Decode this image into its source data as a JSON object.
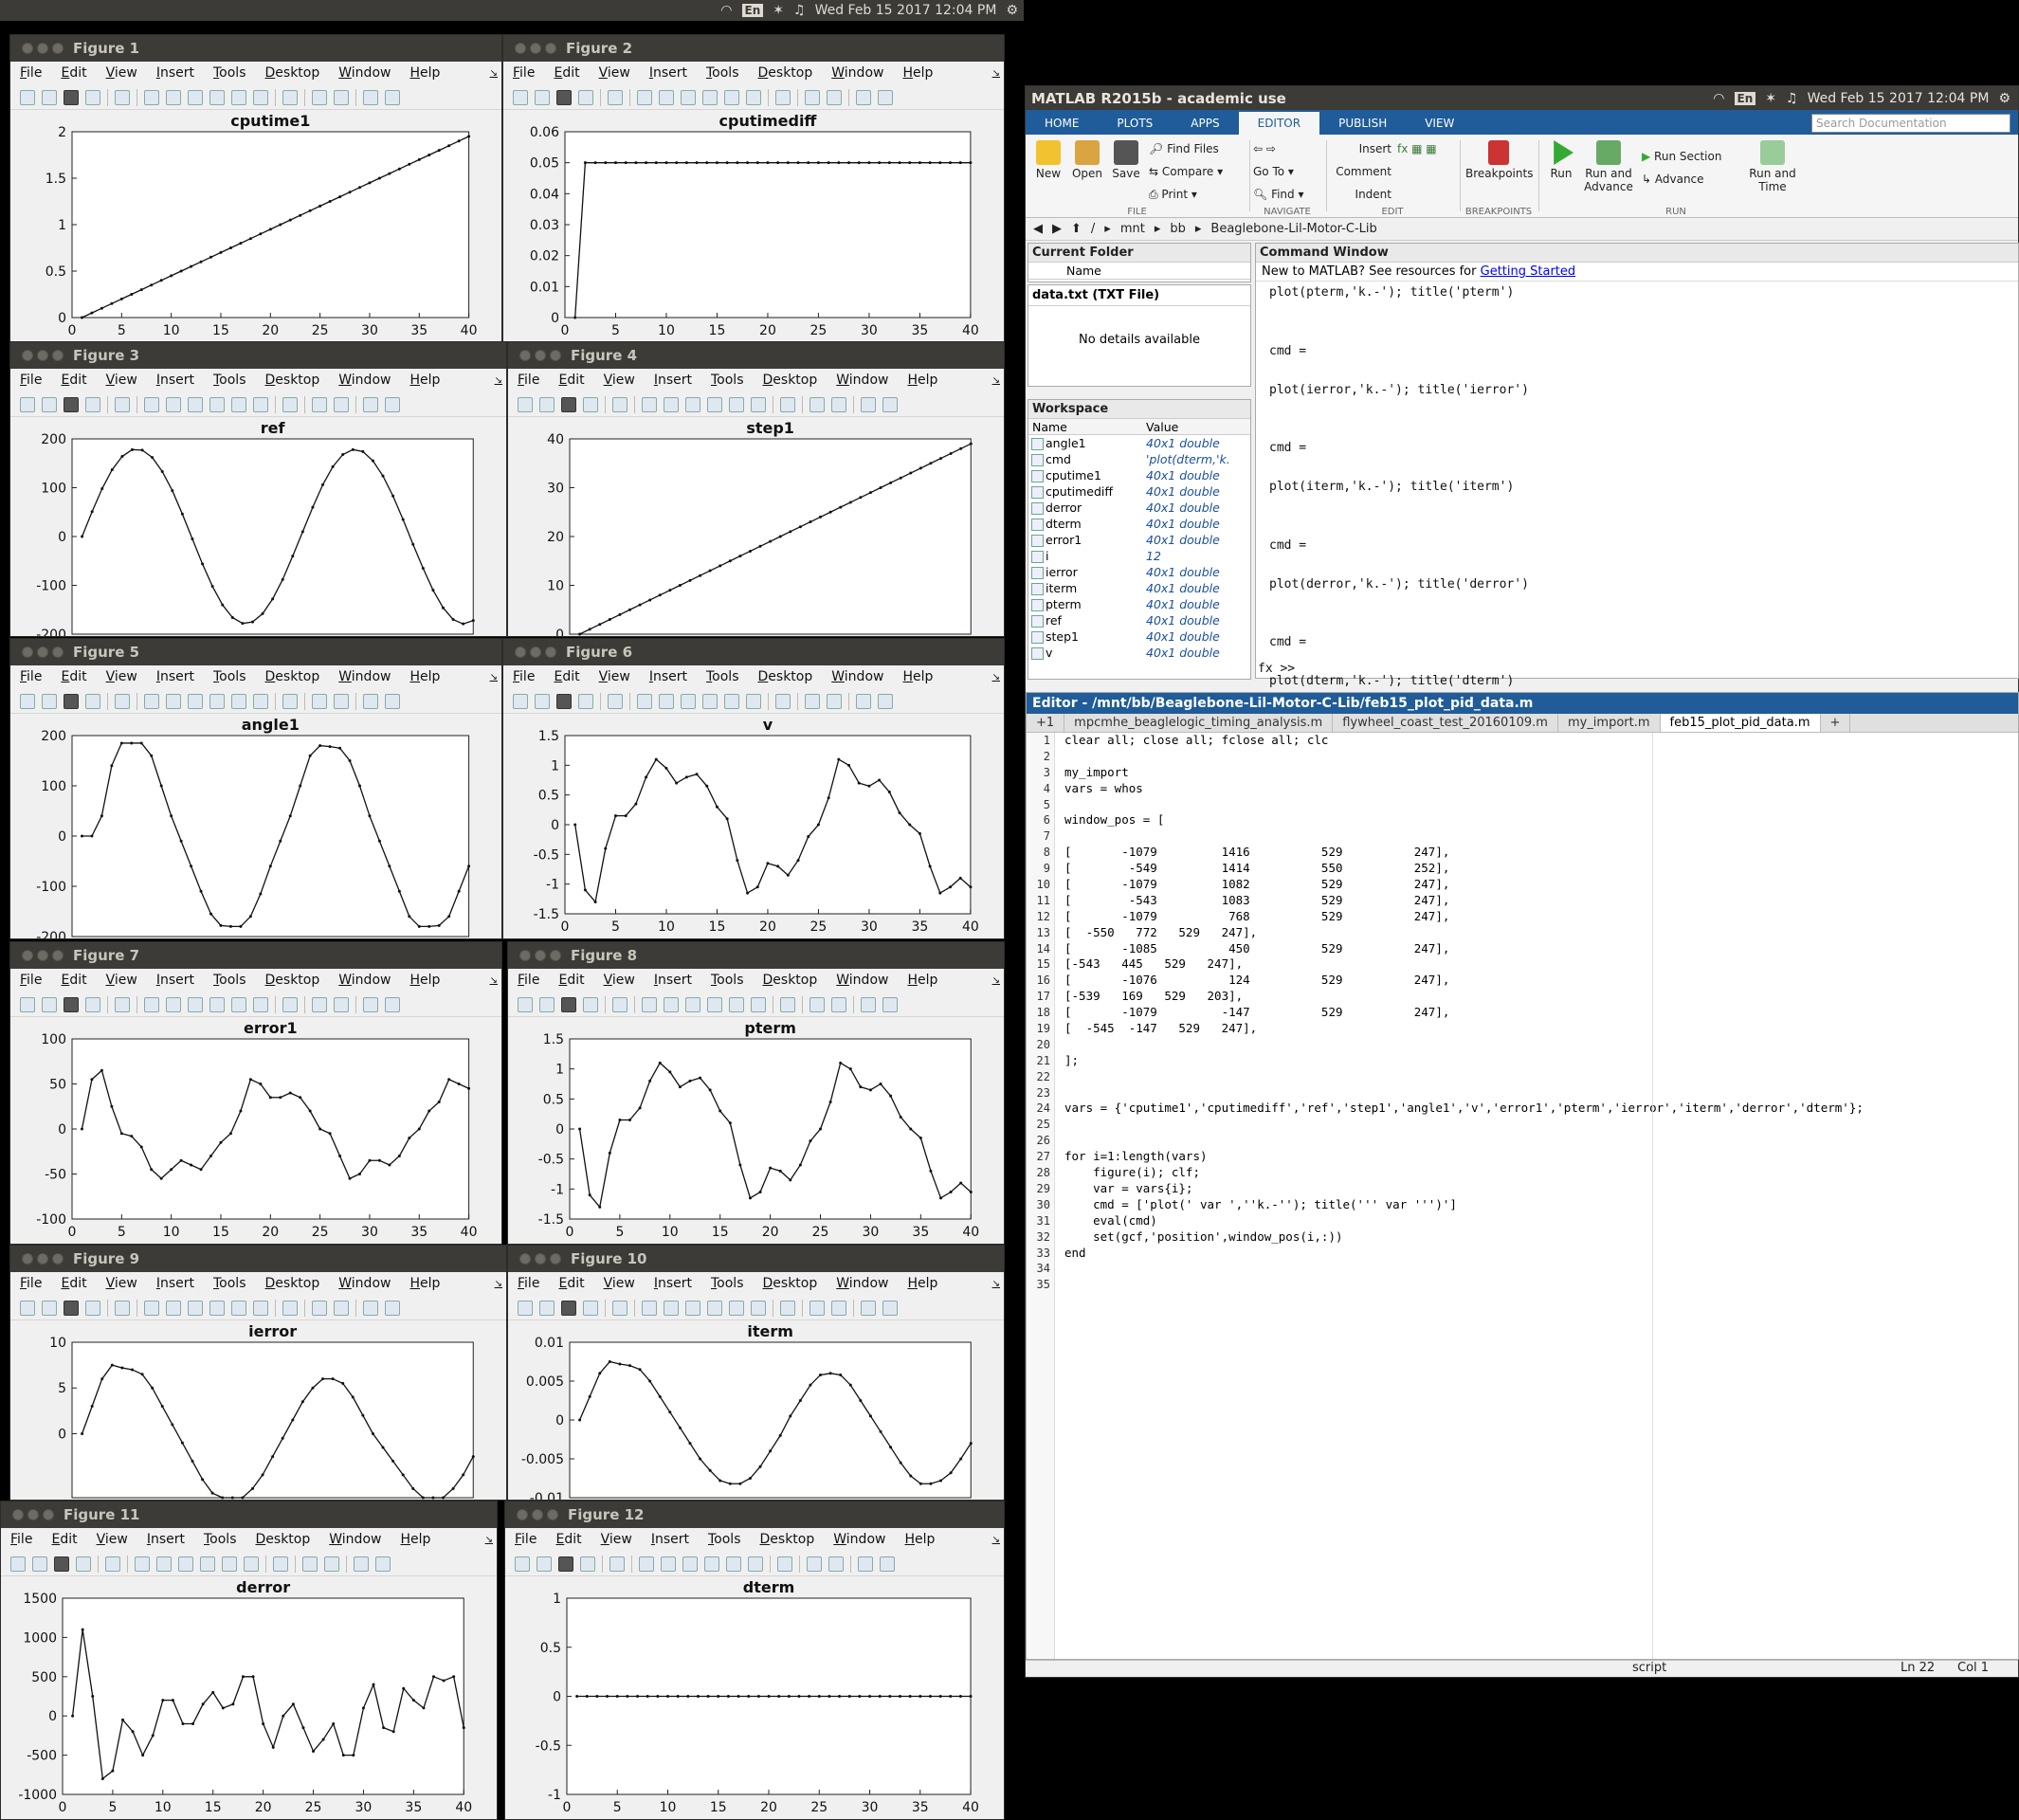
{
  "topbar_left": {
    "lang": "En",
    "datetime": "Wed Feb 15 2017 12:04 PM"
  },
  "figure_menu": [
    "File",
    "Edit",
    "View",
    "Insert",
    "Tools",
    "Desktop",
    "Window",
    "Help"
  ],
  "figures": [
    {
      "window_title": "Figure 1",
      "chart_data": {
        "type": "line",
        "title": "cputime1",
        "xlim": [
          0,
          40
        ],
        "ylim": [
          0,
          2
        ],
        "xticks": [
          0,
          5,
          10,
          15,
          20,
          25,
          30,
          35,
          40
        ],
        "yticks": [
          0,
          0.5,
          1,
          1.5,
          2
        ],
        "y": [
          0,
          0.05,
          0.1,
          0.15,
          0.2,
          0.25,
          0.3,
          0.35,
          0.4,
          0.45,
          0.5,
          0.55,
          0.6,
          0.65,
          0.7,
          0.75,
          0.8,
          0.85,
          0.9,
          0.95,
          1,
          1.05,
          1.1,
          1.15,
          1.2,
          1.25,
          1.3,
          1.35,
          1.4,
          1.45,
          1.5,
          1.55,
          1.6,
          1.65,
          1.7,
          1.75,
          1.8,
          1.85,
          1.9,
          1.95
        ]
      }
    },
    {
      "window_title": "Figure 2",
      "chart_data": {
        "type": "line",
        "title": "cputimediff",
        "xlim": [
          0,
          40
        ],
        "ylim": [
          0,
          0.06
        ],
        "xticks": [
          0,
          5,
          10,
          15,
          20,
          25,
          30,
          35,
          40
        ],
        "yticks": [
          0,
          0.01,
          0.02,
          0.03,
          0.04,
          0.05,
          0.06
        ],
        "y": [
          0,
          0.05,
          0.05,
          0.05,
          0.05,
          0.05,
          0.05,
          0.05,
          0.05,
          0.05,
          0.05,
          0.05,
          0.05,
          0.05,
          0.05,
          0.05,
          0.05,
          0.05,
          0.05,
          0.05,
          0.05,
          0.05,
          0.05,
          0.05,
          0.05,
          0.05,
          0.05,
          0.05,
          0.05,
          0.05,
          0.05,
          0.05,
          0.05,
          0.05,
          0.05,
          0.05,
          0.05,
          0.05,
          0.05,
          0.05
        ]
      }
    },
    {
      "window_title": "Figure 3",
      "chart_data": {
        "type": "line",
        "title": "ref",
        "xlim": [
          0,
          40
        ],
        "ylim": [
          -200,
          200
        ],
        "xticks": [],
        "yticks": [
          -200,
          -100,
          0,
          100,
          200
        ],
        "y": [
          0,
          51,
          98,
          137,
          164,
          178,
          177,
          162,
          133,
          94,
          46,
          -5,
          -56,
          -102,
          -140,
          -166,
          -178,
          -175,
          -158,
          -128,
          -88,
          -40,
          10,
          60,
          106,
          143,
          168,
          178,
          174,
          155,
          124,
          83,
          35,
          -16,
          -65,
          -110,
          -146,
          -170,
          -179,
          -172
        ]
      }
    },
    {
      "window_title": "Figure 4",
      "chart_data": {
        "type": "line",
        "title": "step1",
        "xlim": [
          0,
          40
        ],
        "ylim": [
          0,
          40
        ],
        "xticks": [],
        "yticks": [
          0,
          10,
          20,
          30,
          40
        ],
        "y": [
          0,
          1,
          2,
          3,
          4,
          5,
          6,
          7,
          8,
          9,
          10,
          11,
          12,
          13,
          14,
          15,
          16,
          17,
          18,
          19,
          20,
          21,
          22,
          23,
          24,
          25,
          26,
          27,
          28,
          29,
          30,
          31,
          32,
          33,
          34,
          35,
          36,
          37,
          38,
          39
        ]
      }
    },
    {
      "window_title": "Figure 5",
      "chart_data": {
        "type": "line",
        "title": "angle1",
        "xlim": [
          0,
          40
        ],
        "ylim": [
          -200,
          200
        ],
        "xticks": [],
        "yticks": [
          -200,
          -100,
          0,
          100,
          200
        ],
        "y": [
          0,
          0,
          40,
          140,
          185,
          185,
          185,
          160,
          100,
          40,
          -10,
          -60,
          -110,
          -155,
          -178,
          -180,
          -180,
          -160,
          -115,
          -60,
          -10,
          40,
          100,
          160,
          180,
          178,
          175,
          150,
          100,
          40,
          -10,
          -60,
          -110,
          -160,
          -180,
          -180,
          -178,
          -160,
          -110,
          -60
        ]
      }
    },
    {
      "window_title": "Figure 6",
      "chart_data": {
        "type": "line",
        "title": "v",
        "xlim": [
          0,
          40
        ],
        "ylim": [
          -1.5,
          1.5
        ],
        "xticks": [
          0,
          5,
          10,
          15,
          20,
          25,
          30,
          35,
          40
        ],
        "yticks": [
          -1.5,
          -1,
          -0.5,
          0,
          0.5,
          1,
          1.5
        ],
        "y": [
          0,
          -1.1,
          -1.3,
          -0.4,
          0.15,
          0.15,
          0.35,
          0.8,
          1.1,
          0.95,
          0.7,
          0.8,
          0.85,
          0.65,
          0.3,
          0.1,
          -0.6,
          -1.15,
          -1.05,
          -0.65,
          -0.7,
          -0.85,
          -0.6,
          -0.2,
          0.0,
          0.45,
          1.1,
          1.0,
          0.7,
          0.65,
          0.75,
          0.55,
          0.2,
          0.0,
          -0.15,
          -0.7,
          -1.15,
          -1.05,
          -0.9,
          -1.05
        ]
      }
    },
    {
      "window_title": "Figure 7",
      "chart_data": {
        "type": "line",
        "title": "error1",
        "xlim": [
          0,
          40
        ],
        "ylim": [
          -100,
          100
        ],
        "xticks": [
          0,
          5,
          10,
          15,
          20,
          25,
          30,
          35,
          40
        ],
        "yticks": [
          -100,
          -50,
          0,
          50,
          100
        ],
        "y": [
          0,
          55,
          65,
          25,
          -5,
          -8,
          -20,
          -45,
          -55,
          -45,
          -35,
          -40,
          -45,
          -30,
          -15,
          -5,
          20,
          55,
          50,
          35,
          35,
          40,
          35,
          20,
          0,
          -5,
          -30,
          -55,
          -50,
          -35,
          -35,
          -40,
          -30,
          -10,
          0,
          20,
          30,
          55,
          50,
          45
        ]
      }
    },
    {
      "window_title": "Figure 8",
      "chart_data": {
        "type": "line",
        "title": "pterm",
        "xlim": [
          0,
          40
        ],
        "ylim": [
          -1.5,
          1.5
        ],
        "xticks": [
          0,
          5,
          10,
          15,
          20,
          25,
          30,
          35,
          40
        ],
        "yticks": [
          -1.5,
          -1,
          -0.5,
          0,
          0.5,
          1,
          1.5
        ],
        "y": [
          0,
          -1.1,
          -1.3,
          -0.4,
          0.15,
          0.15,
          0.35,
          0.8,
          1.1,
          0.95,
          0.7,
          0.8,
          0.85,
          0.65,
          0.3,
          0.1,
          -0.6,
          -1.15,
          -1.05,
          -0.65,
          -0.7,
          -0.85,
          -0.6,
          -0.2,
          0.0,
          0.45,
          1.1,
          1.0,
          0.7,
          0.65,
          0.75,
          0.55,
          0.2,
          0.0,
          -0.15,
          -0.7,
          -1.15,
          -1.05,
          -0.9,
          -1.05
        ]
      }
    },
    {
      "window_title": "Figure 9",
      "chart_data": {
        "type": "line",
        "title": "ierror",
        "xlim": [
          0,
          40
        ],
        "ylim": [
          -7,
          10
        ],
        "xticks": [],
        "yticks": [
          0,
          5,
          10
        ],
        "y": [
          0,
          3,
          6,
          7.5,
          7.2,
          7,
          6.5,
          5,
          3,
          1,
          -1,
          -3,
          -5,
          -6.5,
          -7,
          -7,
          -7,
          -6,
          -4.5,
          -2.5,
          -0.5,
          1.5,
          3.5,
          5,
          6,
          6,
          5.5,
          4,
          2,
          0,
          -1.5,
          -3,
          -4.5,
          -6,
          -7,
          -7,
          -7,
          -6,
          -4.5,
          -2.5
        ]
      }
    },
    {
      "window_title": "Figure 10",
      "chart_data": {
        "type": "line",
        "title": "iterm",
        "xlim": [
          0,
          40
        ],
        "ylim": [
          -0.01,
          0.01
        ],
        "xticks": [],
        "yticks": [
          -0.01,
          -0.005,
          0,
          0.005,
          0.01
        ],
        "y": [
          0,
          0.003,
          0.006,
          0.0075,
          0.0072,
          0.007,
          0.0065,
          0.005,
          0.003,
          0.001,
          -0.001,
          -0.003,
          -0.005,
          -0.0065,
          -0.0078,
          -0.0082,
          -0.0082,
          -0.0075,
          -0.006,
          -0.004,
          -0.002,
          0.0005,
          0.0025,
          0.0045,
          0.0058,
          0.006,
          0.0058,
          0.0045,
          0.0025,
          0.0005,
          -0.0015,
          -0.0035,
          -0.0055,
          -0.0072,
          -0.0082,
          -0.0082,
          -0.0078,
          -0.0068,
          -0.005,
          -0.003
        ]
      }
    },
    {
      "window_title": "Figure 11",
      "chart_data": {
        "type": "line",
        "title": "derror",
        "xlim": [
          0,
          40
        ],
        "ylim": [
          -1000,
          1500
        ],
        "xticks": [
          0,
          5,
          10,
          15,
          20,
          25,
          30,
          35,
          40
        ],
        "yticks": [
          -1000,
          -500,
          0,
          500,
          1000,
          1500
        ],
        "y": [
          0,
          1100,
          250,
          -800,
          -700,
          -50,
          -200,
          -500,
          -250,
          200,
          200,
          -100,
          -100,
          150,
          300,
          100,
          150,
          500,
          500,
          -100,
          -400,
          0,
          150,
          -150,
          -450,
          -300,
          -100,
          -500,
          -500,
          100,
          400,
          -150,
          -200,
          350,
          200,
          100,
          500,
          450,
          500,
          -150
        ]
      }
    },
    {
      "window_title": "Figure 12",
      "chart_data": {
        "type": "line",
        "title": "dterm",
        "xlim": [
          0,
          40
        ],
        "ylim": [
          -1,
          1
        ],
        "xticks": [
          0,
          5,
          10,
          15,
          20,
          25,
          30,
          35,
          40
        ],
        "yticks": [
          -1,
          -0.5,
          0,
          0.5,
          1
        ],
        "y": [
          0,
          0,
          0,
          0,
          0,
          0,
          0,
          0,
          0,
          0,
          0,
          0,
          0,
          0,
          0,
          0,
          0,
          0,
          0,
          0,
          0,
          0,
          0,
          0,
          0,
          0,
          0,
          0,
          0,
          0,
          0,
          0,
          0,
          0,
          0,
          0,
          0,
          0,
          0,
          0
        ]
      }
    }
  ],
  "matlab": {
    "title": "MATLAB R2015b - academic use",
    "lang": "En",
    "datetime": "Wed Feb 15 2017 12:04 PM",
    "tabs": [
      "HOME",
      "PLOTS",
      "APPS",
      "EDITOR",
      "PUBLISH",
      "VIEW"
    ],
    "search_placeholder": "Search Documentation",
    "ribbon": {
      "new": "New",
      "open": "Open",
      "save": "Save",
      "find_files": "Find Files",
      "compare": "Compare",
      "print": "Print",
      "go_to": "Go To",
      "find": "Find",
      "insert": "Insert",
      "comment": "Comment",
      "indent": "Indent",
      "breakpoints": "Breakpoints",
      "run": "Run",
      "run_advance": "Run and Advance",
      "run_section": "Run Section",
      "advance": "Advance",
      "run_time": "Run and Time",
      "groups": {
        "file": "FILE",
        "navigate": "NAVIGATE",
        "edit": "EDIT",
        "breakpoints": "BREAKPOINTS",
        "run": "RUN"
      }
    },
    "path": [
      "/",
      "mnt",
      "bb",
      "Beaglebone-Lil-Motor-C-Lib"
    ],
    "current_folder": {
      "title": "Current Folder",
      "col_name": "Name"
    },
    "details": {
      "file": "data.txt  (TXT File)",
      "msg": "No details available"
    },
    "workspace": {
      "title": "Workspace",
      "col_name": "Name",
      "col_value": "Value",
      "rows": [
        {
          "name": "angle1",
          "value": "40x1 double"
        },
        {
          "name": "cmd",
          "value": "'plot(dterm,'k."
        },
        {
          "name": "cputime1",
          "value": "40x1 double"
        },
        {
          "name": "cputimediff",
          "value": "40x1 double"
        },
        {
          "name": "derror",
          "value": "40x1 double"
        },
        {
          "name": "dterm",
          "value": "40x1 double"
        },
        {
          "name": "error1",
          "value": "40x1 double"
        },
        {
          "name": "i",
          "value": "12"
        },
        {
          "name": "ierror",
          "value": "40x1 double"
        },
        {
          "name": "iterm",
          "value": "40x1 double"
        },
        {
          "name": "pterm",
          "value": "40x1 double"
        },
        {
          "name": "ref",
          "value": "40x1 double"
        },
        {
          "name": "step1",
          "value": "40x1 double"
        },
        {
          "name": "v",
          "value": "40x1 double"
        }
      ]
    },
    "command_window": {
      "title": "Command Window",
      "banner": "New to MATLAB? See resources for ",
      "banner_link": "Getting Started",
      "lines": [
        "plot(pterm,'k.-'); title('pterm')",
        "",
        "",
        "cmd =",
        "",
        "plot(ierror,'k.-'); title('ierror')",
        "",
        "",
        "cmd =",
        "",
        "plot(iterm,'k.-'); title('iterm')",
        "",
        "",
        "cmd =",
        "",
        "plot(derror,'k.-'); title('derror')",
        "",
        "",
        "cmd =",
        "",
        "plot(dterm,'k.-'); title('dterm')"
      ],
      "prompt": "fx >>"
    },
    "editor": {
      "title": "Editor - /mnt/bb/Beaglebone-Lil-Motor-C-Lib/feb15_plot_pid_data.m",
      "tabs": [
        "+1",
        "mpcmhe_beaglelogic_timing_analysis.m",
        "flywheel_coast_test_20160109.m",
        "my_import.m",
        "feb15_plot_pid_data.m"
      ],
      "lines": [
        "clear all; close all; fclose all; clc",
        "",
        "my_import",
        "vars = whos",
        "",
        "window_pos = [",
        "",
        "[       -1079         1416          529          247],",
        "[        -549         1414          550          252],",
        "[       -1079         1082          529          247],",
        "[        -543         1083          529          247],",
        "[       -1079          768          529          247],",
        "[  -550   772   529   247],",
        "[       -1085          450          529          247],",
        "[-543   445   529   247],",
        "[       -1076          124          529          247],",
        "[-539   169   529   203],",
        "[       -1079         -147          529          247],",
        "[  -545  -147   529   247],",
        "",
        "];",
        "",
        "",
        "vars = {'cputime1','cputimediff','ref','step1','angle1','v','error1','pterm','ierror','iterm','derror','dterm'};",
        "",
        "",
        "for i=1:length(vars)",
        "    figure(i); clf;",
        "    var = vars{i};",
        "    cmd = ['plot(' var ',''k.-''); title(''' var ''')']",
        "    eval(cmd)",
        "    set(gcf,'position',window_pos(i,:))",
        "end",
        "",
        ""
      ]
    },
    "status": {
      "mode": "script",
      "ln": "Ln  22",
      "col": "Col  1"
    }
  }
}
